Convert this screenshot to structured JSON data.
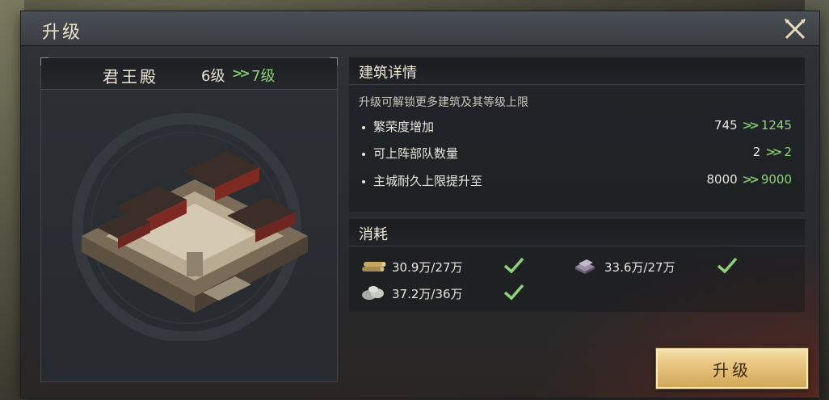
{
  "dialog": {
    "title": "升级"
  },
  "building": {
    "name": "君王殿",
    "level_from": "6级",
    "level_arrow": ">>",
    "level_to": "7级"
  },
  "details": {
    "title": "建筑详情",
    "description": "升级可解锁更多建筑及其等级上限",
    "stats": [
      {
        "label": "繁荣度增加",
        "from": "745",
        "to": "1245"
      },
      {
        "label": "可上阵部队数量",
        "from": "2",
        "to": "2"
      },
      {
        "label": "主城耐久上限提升至",
        "from": "8000",
        "to": "9000"
      }
    ],
    "arrow": ">>"
  },
  "cost": {
    "title": "消耗",
    "items": [
      {
        "icon": "wood-icon",
        "amount": "30.9万/27万",
        "met": true
      },
      {
        "icon": "iron-icon",
        "amount": "33.6万/27万",
        "met": true
      },
      {
        "icon": "stone-icon",
        "amount": "37.2万/36万",
        "met": true
      }
    ]
  },
  "actions": {
    "upgrade_label": "升级"
  },
  "colors": {
    "green": "#8ed17b",
    "gold": "#e6c27a",
    "text": "#e9e6de"
  }
}
